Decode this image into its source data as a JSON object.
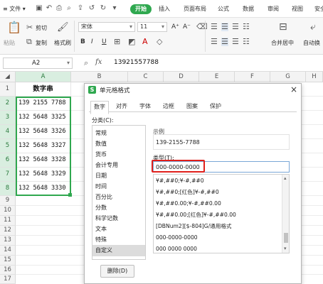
{
  "menubar": {
    "file_label": "≡ 文件 ▾",
    "start_tab": "开始",
    "tabs": [
      "插入",
      "页面布局",
      "公式",
      "数据",
      "审阅",
      "视图",
      "安全"
    ]
  },
  "ribbon": {
    "paste_label": "粘贴",
    "cut_label": "剪切",
    "copy_label": "复制",
    "format_painter_label": "格式刷",
    "font_name": "宋体",
    "font_size": "11",
    "bold": "B",
    "italic": "I",
    "underline": "U",
    "grow_font": "A⁺",
    "shrink_font": "A⁻",
    "merge_label": "合并居中",
    "autowrap_label": "自动换"
  },
  "formula_bar": {
    "name_box": "A2",
    "fx": "fx",
    "value": "13921557788"
  },
  "sheet": {
    "columns": [
      "A",
      "B",
      "C",
      "D",
      "E",
      "F",
      "G",
      "H"
    ],
    "header_cell": "数字串",
    "rows": [
      "1",
      "2",
      "3",
      "4",
      "5",
      "6",
      "7",
      "8",
      "9",
      "10",
      "11",
      "12",
      "13",
      "14",
      "15",
      "16",
      "17",
      "18"
    ],
    "data": [
      "139 2155 7788",
      "132 5648 3325",
      "132 5648 3326",
      "132 5648 3327",
      "132 5648 3328",
      "132 5648 3329",
      "132 5648 3330"
    ]
  },
  "dialog": {
    "title": "单元格格式",
    "close": "×",
    "tabs": [
      "数字",
      "对齐",
      "字体",
      "边框",
      "图案",
      "保护"
    ],
    "category_label": "分类(C):",
    "categories": [
      "常规",
      "数值",
      "货币",
      "会计专用",
      "日期",
      "时间",
      "百分比",
      "分数",
      "科学记数",
      "文本",
      "特殊",
      "自定义"
    ],
    "sample_label": "示例",
    "sample_value": "139-2155-7788",
    "type_label": "类型(T):",
    "type_value": "000-0000-0000",
    "formats": [
      "¥#,##0;¥-#,##0",
      "¥#,##0;[红色]¥-#,##0",
      "¥#,##0.00;¥-#,##0.00",
      "¥#,##0.00;[红色]¥-#,##0.00",
      "[DBNum2][$-804]G/通用格式",
      "000-0000-0000",
      "000 0000 0000"
    ],
    "delete_button": "删除(D)",
    "accent_color": "#2fa84f",
    "highlight_color": "#e0201c"
  }
}
